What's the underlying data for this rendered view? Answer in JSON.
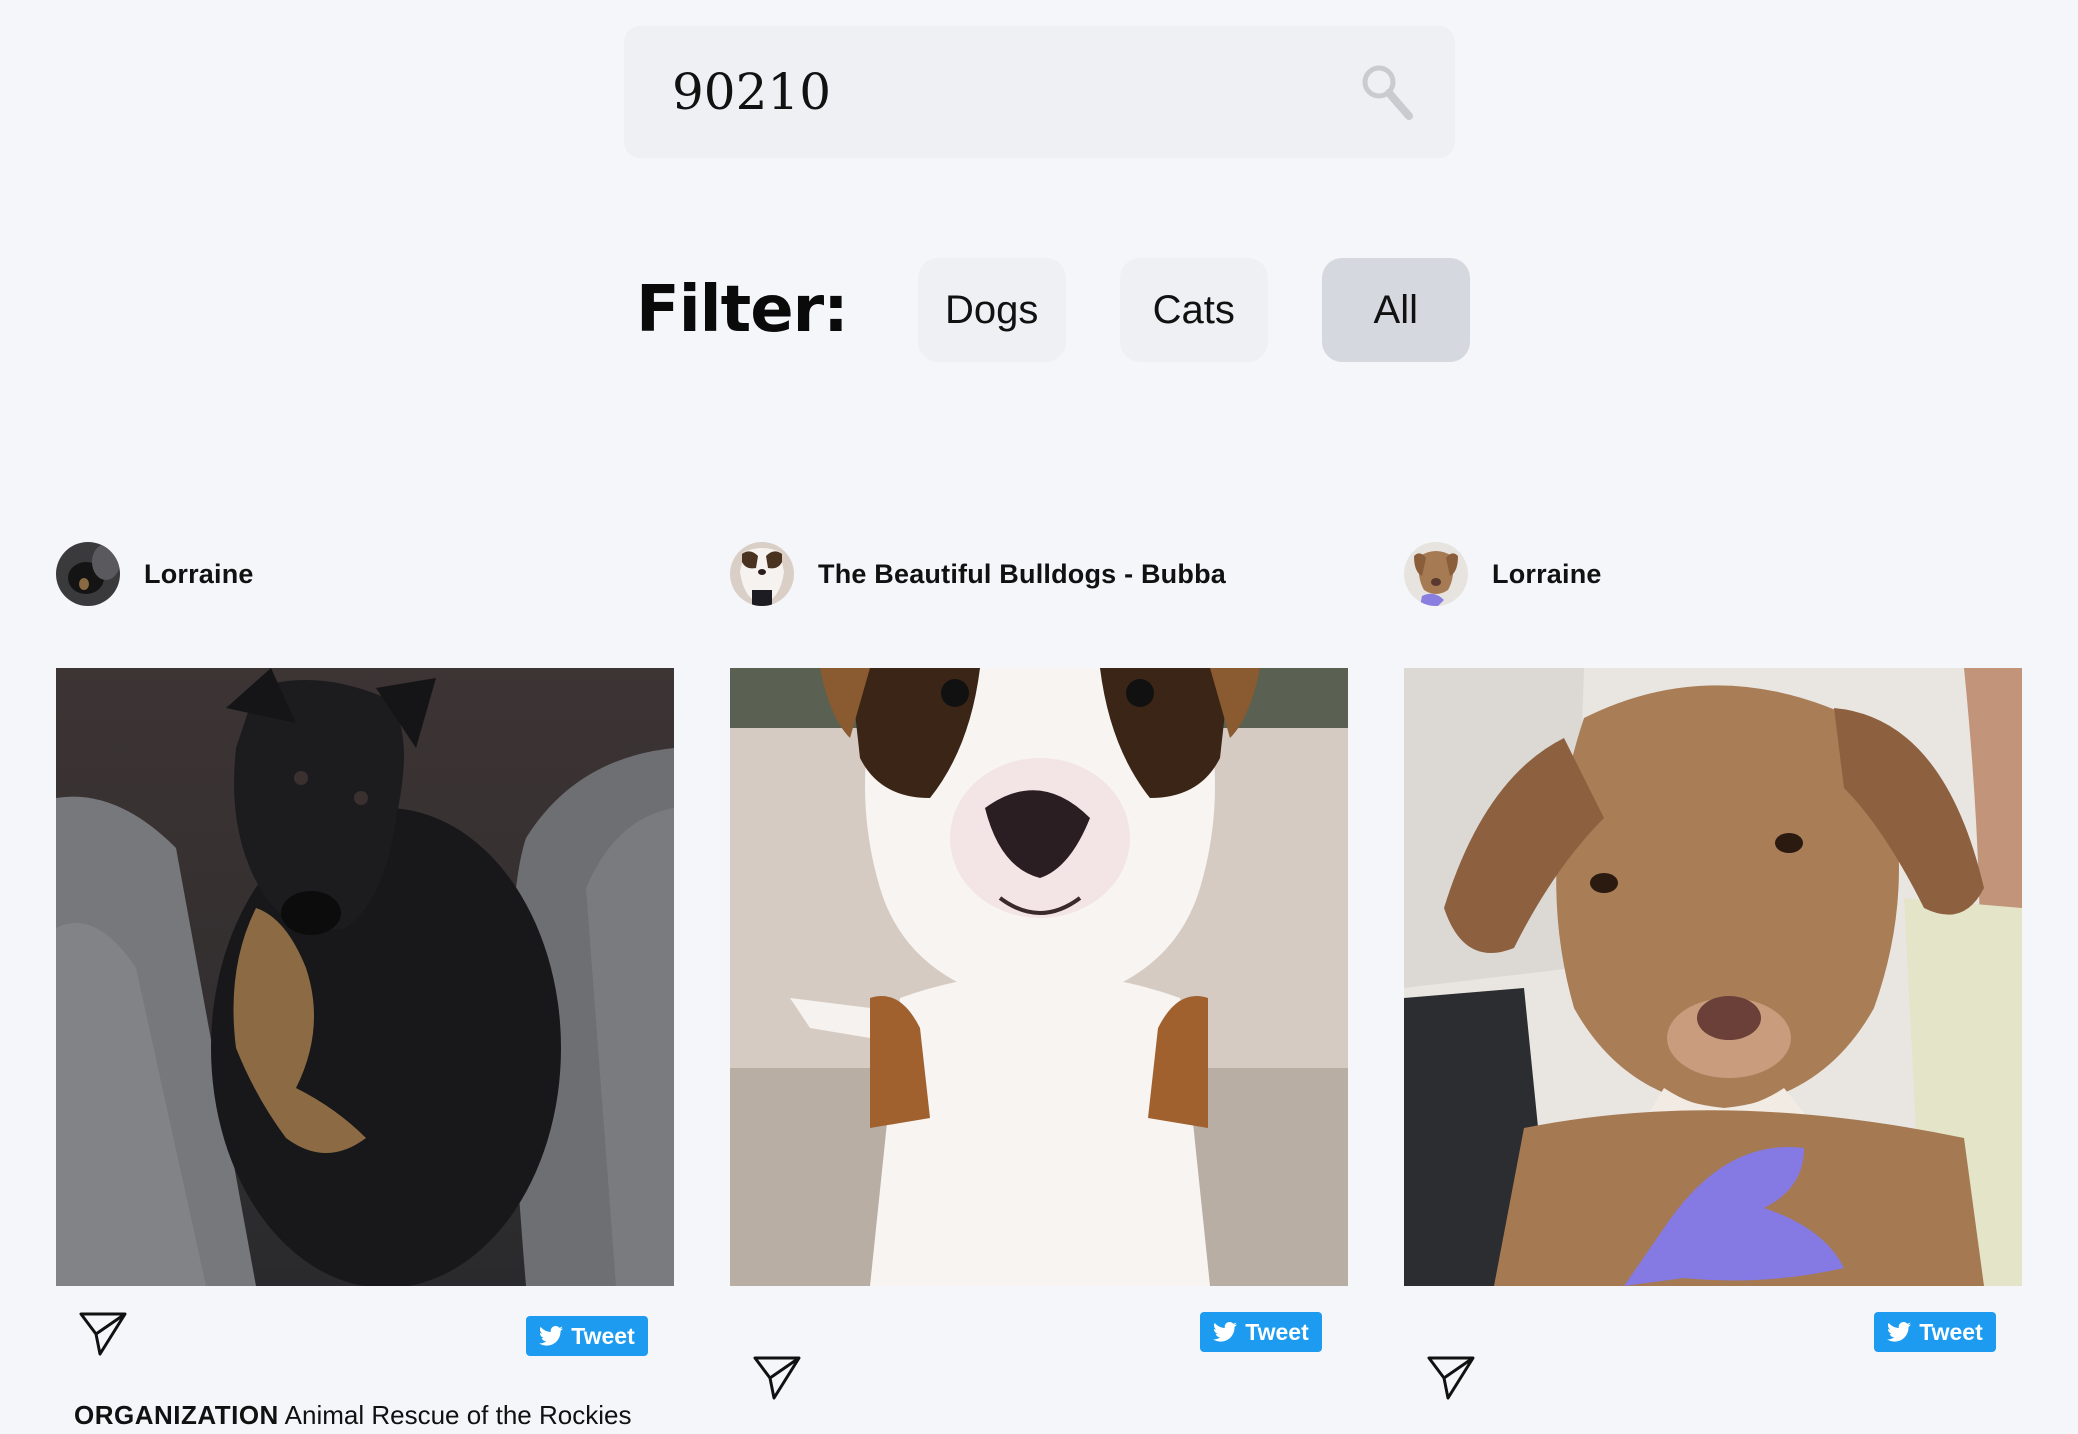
{
  "search": {
    "value": "90210"
  },
  "filter": {
    "label": "Filter:",
    "options": [
      "Dogs",
      "Cats",
      "All"
    ],
    "active": "All"
  },
  "cards": [
    {
      "poster": "Lorraine",
      "tweet_label": "Tweet",
      "organization_label": "ORGANIZATION",
      "organization_name": "Animal Rescue of the Rockies"
    },
    {
      "poster": "The Beautiful Bulldogs - Bubba",
      "tweet_label": "Tweet"
    },
    {
      "poster": "Lorraine",
      "tweet_label": "Tweet"
    }
  ],
  "colors": {
    "background": "#f5f6fa",
    "tweet_button": "#1d9bf0",
    "active_chip": "#d5d8de"
  },
  "icons": [
    "search-icon",
    "send-icon",
    "twitter-bird-icon"
  ]
}
